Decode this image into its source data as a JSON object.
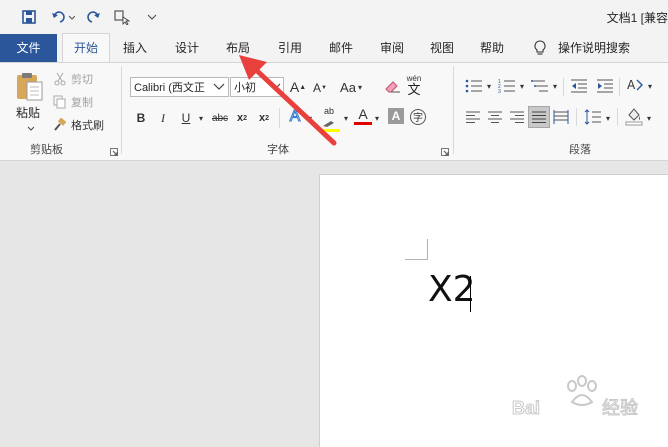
{
  "window": {
    "title": "文档1 [兼容"
  },
  "tabs": [
    "文件",
    "开始",
    "插入",
    "设计",
    "布局",
    "引用",
    "邮件",
    "审阅",
    "视图",
    "帮助"
  ],
  "tell_me": "操作说明搜索",
  "clipboard": {
    "paste": "粘贴",
    "cut": "剪切",
    "copy": "复制",
    "format_painter": "格式刷",
    "label": "剪贴板"
  },
  "font": {
    "font_name": "Calibri (西文正",
    "font_size": "小初",
    "change_case": "Aa",
    "phonetic": "wén",
    "label": "字体"
  },
  "paragraph": {
    "label": "段落"
  },
  "document": {
    "text": "X2"
  },
  "colors": {
    "accent": "#2b579a",
    "arrow": "#e8413d",
    "font_color_bar": "#e00000",
    "highlight_bar": "#ffff00"
  }
}
